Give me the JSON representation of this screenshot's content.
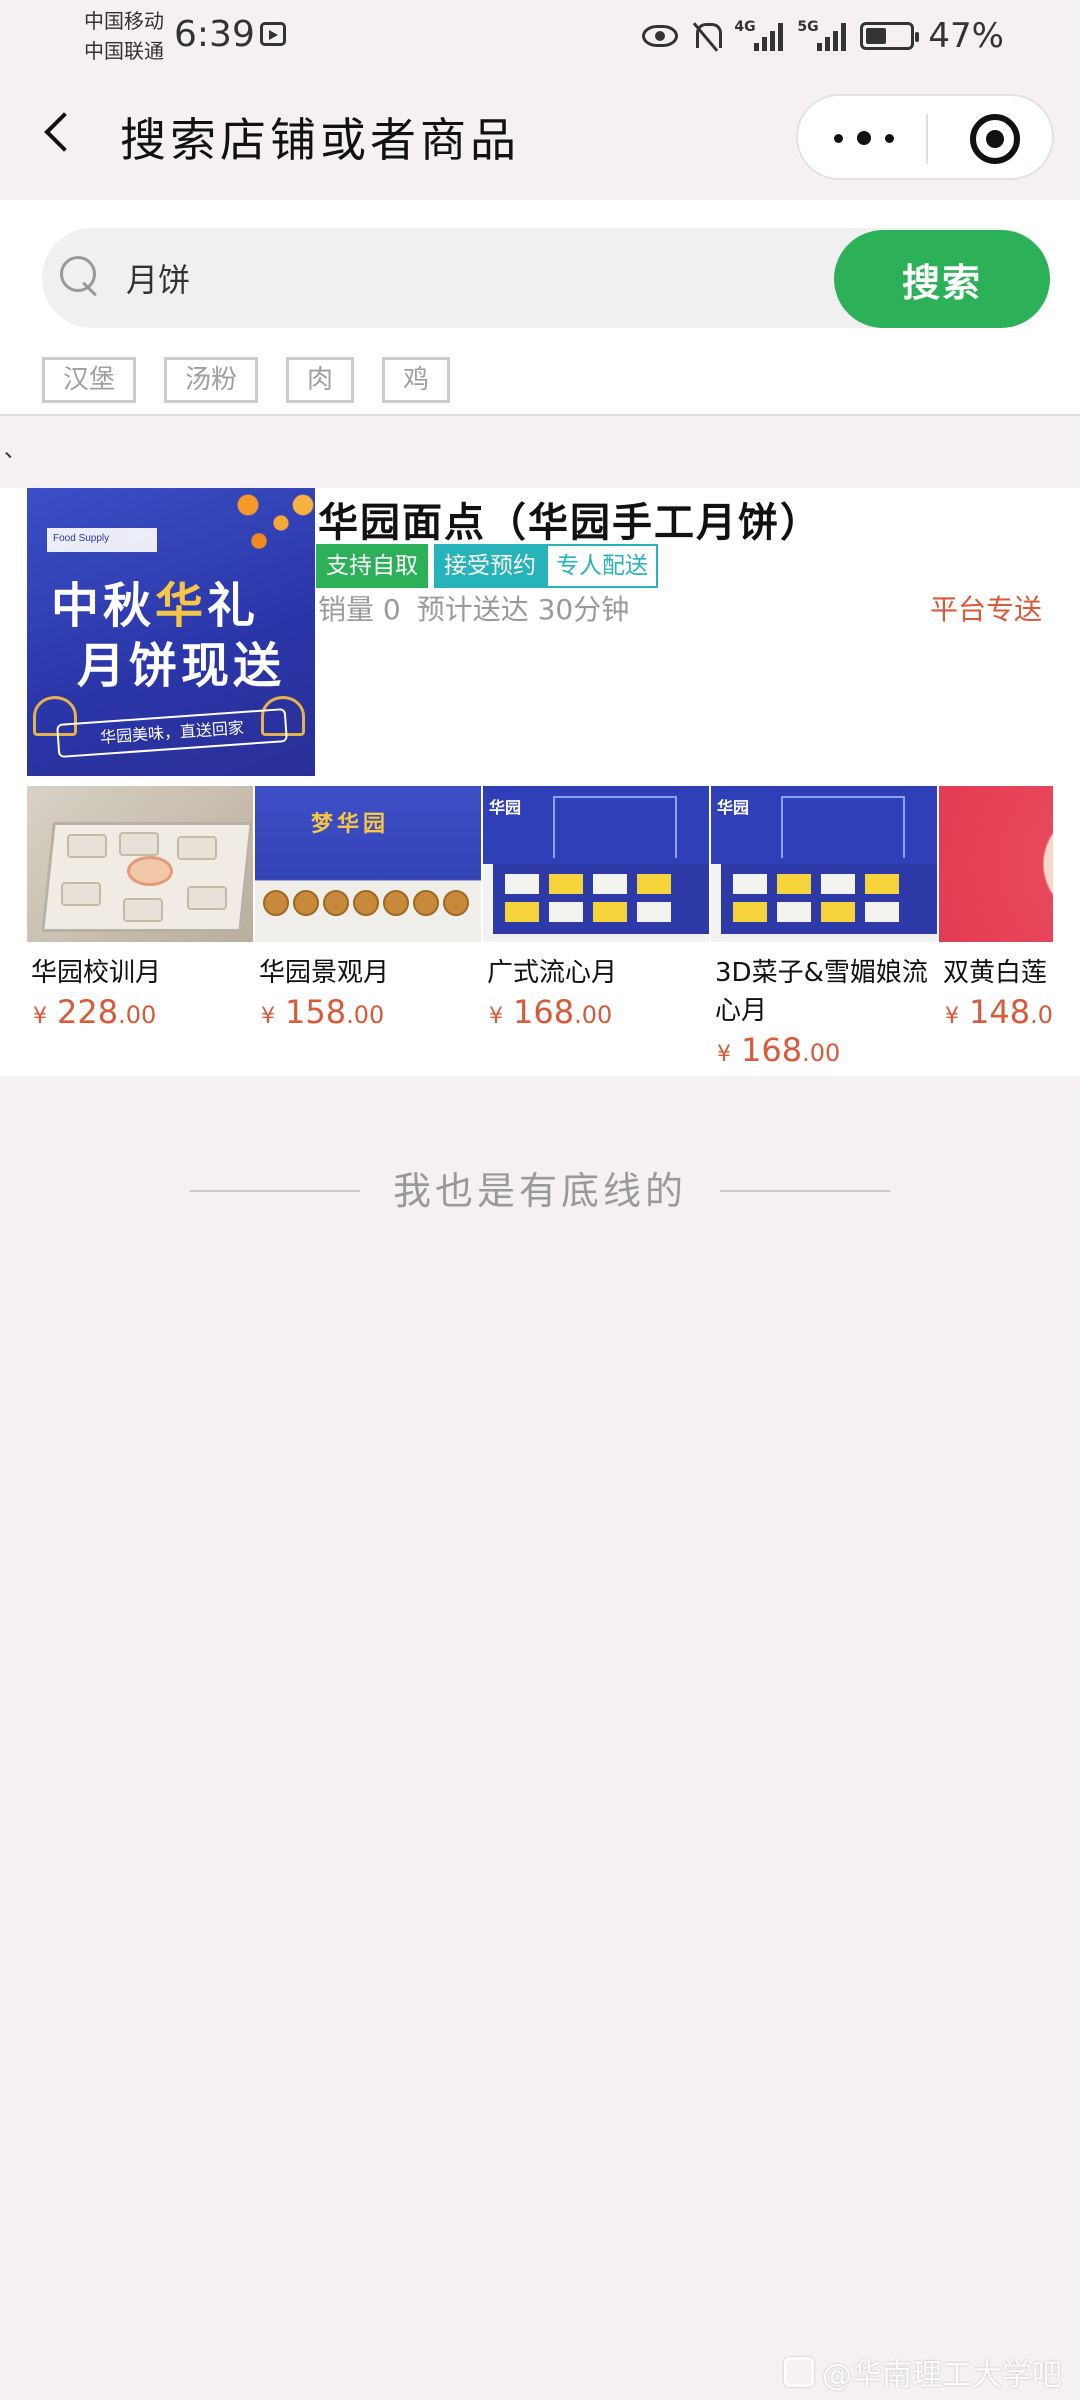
{
  "status_bar": {
    "carrier1": "中国移动",
    "carrier2": "中国联通",
    "time": "6:39",
    "net1": "4G",
    "net2": "5G",
    "battery_level": 0.47,
    "battery_text": "47%"
  },
  "navbar": {
    "title": "搜索店铺或者商品"
  },
  "search": {
    "value": "月饼",
    "button_label": "搜索",
    "tags": [
      "汉堡",
      "汤粉",
      "肉",
      "鸡"
    ]
  },
  "misc_mark": "、",
  "shop": {
    "logo_text": {
      "corner": "Food Supply",
      "line1_a": "中秋",
      "line1_b": "华",
      "line1_c": "礼",
      "line2": "月饼现送",
      "ribbon": "华园美味，直送回家"
    },
    "name": "华园面点（华园手工月饼）",
    "badges": [
      "支持自取",
      "接受预约",
      "专人配送"
    ],
    "sales_label": "销量 0",
    "eta_label": "预计送达 30分钟",
    "delivery": "平台专送",
    "products": [
      {
        "name": "华园校训月",
        "currency": "¥",
        "price_int": "228",
        "price_dec": ".00"
      },
      {
        "name": "华园景观月",
        "currency": "¥",
        "price_int": "158",
        "price_dec": ".00"
      },
      {
        "name": "广式流心月",
        "currency": "¥",
        "price_int": "168",
        "price_dec": ".00"
      },
      {
        "name": "3D菜子&雪媚娘流心月",
        "currency": "¥",
        "price_int": "168",
        "price_dec": ".00"
      },
      {
        "name": "双黄白莲",
        "currency": "¥",
        "price_int": "148",
        "price_dec": ".0"
      }
    ],
    "product_image_labels": {
      "p2_title": "梦华园",
      "p3_logo": "华园",
      "p4_logo": "华园"
    }
  },
  "footer_line": "我也是有底线的",
  "watermark": "@华南理工大学吧",
  "colors": {
    "accent_green": "#2cb159",
    "teal": "#26b3ba",
    "price_red": "#d85a3a",
    "page_bg": "#f5f0f4"
  }
}
